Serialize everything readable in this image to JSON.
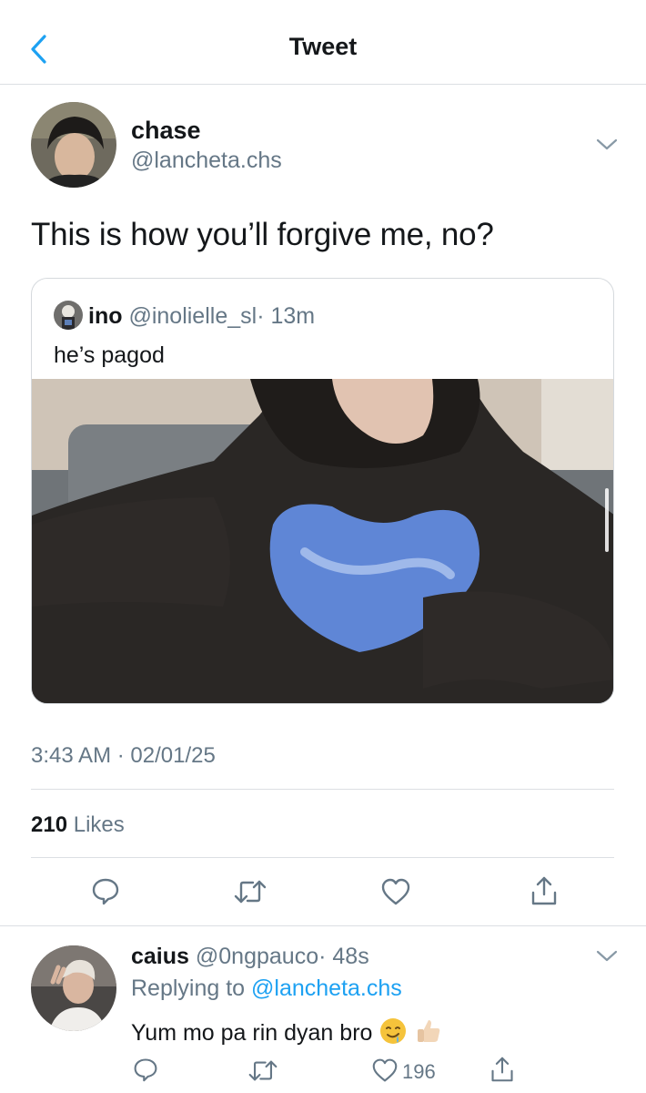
{
  "nav": {
    "title": "Tweet"
  },
  "tweet": {
    "name": "chase",
    "handle": "@lancheta.chs",
    "text": "This is how you’ll forgive me, no?",
    "timestamp": "3:43 AM · 02/01/25",
    "likes_count": "210",
    "likes_label": "Likes"
  },
  "quote": {
    "name": "ino",
    "handle": "@inolielle_sl",
    "time": "· 13m",
    "text": "he’s pagod"
  },
  "reply": {
    "name": "caius",
    "handle": "@0ngpauco",
    "time": "· 48s",
    "replying_prefix": "Replying to",
    "replying_handle": "@lancheta.chs",
    "text": "Yum mo pa rin dyan bro",
    "like_count": "196"
  },
  "icons": {
    "back": "chevron-left-icon",
    "menu": "chevron-down-icon",
    "reply": "comment-icon",
    "retweet": "retweet-icon",
    "like": "heart-icon",
    "share": "share-icon",
    "emoji_1": "drooling-face-emoji",
    "emoji_2": "thumbs-up-emoji"
  },
  "colors": {
    "accent": "#1da1f2",
    "muted": "#657786",
    "divider": "#dcdfe3",
    "text": "#14171a"
  }
}
